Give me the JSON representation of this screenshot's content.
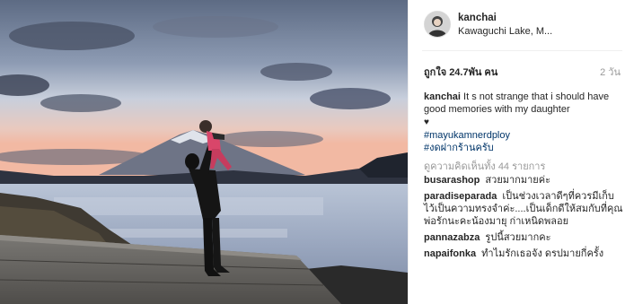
{
  "post": {
    "username": "kanchai",
    "location": "Kawaguchi Lake, M...",
    "likes": "ถูกใจ 24.7พัน คน",
    "time": "2 วัน",
    "caption": {
      "username": "kanchai",
      "text": "It s not strange that i should have good memories with my daughter",
      "emoji": "♥",
      "hashtags": [
        "#mayukamnerdploy",
        "#งดฝากร้านครับ"
      ]
    },
    "view_all_comments": "ดูความคิดเห็นทั้ง 44 รายการ",
    "comments": [
      {
        "username": "busarashop",
        "text": "สวยมากมายค่ะ"
      },
      {
        "username": "paradiseparada",
        "text": "เป็นช่วงเวลาดีๆที่ควรมีเก็บไว้เป็นความทรงจำค่ะ....เป็นเด็กดีให้สมกับที่คุณพ่อรักนะคะน้องมายุ ก่าเหนิดพลอย"
      },
      {
        "username": "pannazabza",
        "text": "รูปนี้สวยมากคะ"
      },
      {
        "username": "napaifonka",
        "text": "ทำไมรักเธอจัง ดรปมายกี่ครั้ง"
      }
    ]
  }
}
